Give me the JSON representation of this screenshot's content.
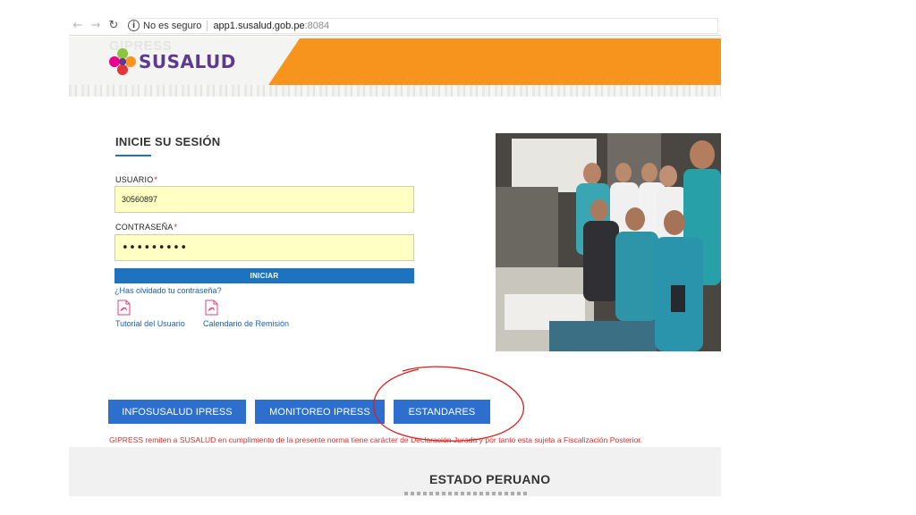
{
  "browser": {
    "back_icon": "arrow-left",
    "forward_icon": "arrow-right",
    "reload_icon": "reload",
    "info_icon": "i",
    "security_label": "No es seguro",
    "url_host": "app1.susalud.gob.pe",
    "url_port": ":8084"
  },
  "header": {
    "ghost_text": "GIPRESS",
    "logo_text": "SUSALUD",
    "accent_color": "#f7941d"
  },
  "login": {
    "title": "INICIE SU SESIÓN",
    "user_label": "USUARIO",
    "user_value": "30560897",
    "password_label": "CONTRASEÑA",
    "password_value": "•••••••••",
    "required_mark": "*",
    "submit_label": "INICIAR",
    "forgot_link": "¿Has olvidado tu contraseña?",
    "docs": [
      {
        "label": "Tutorial del Usuario",
        "icon": "pdf-icon"
      },
      {
        "label": "Calendario de Remisión",
        "icon": "pdf-icon"
      }
    ]
  },
  "buttons": [
    {
      "label": "INFOSUSALUD IPRESS"
    },
    {
      "label": "MONITOREO IPRESS"
    },
    {
      "label": "ESTANDARES"
    }
  ],
  "disclaimer": "GIPRESS remiten a SUSALUD en cumplimiento de la presente norma tiene carácter de Declaración Jurada y por tanto esta sujeta a Fiscalización Posterior.",
  "footer": {
    "title": "ESTADO PERUANO"
  },
  "colors": {
    "primary_blue": "#1e73be",
    "button_blue": "#2c6fcf",
    "annotation_red": "#d8201f",
    "disclaimer_red": "#e02b27",
    "input_yellow": "#ffffc4"
  }
}
